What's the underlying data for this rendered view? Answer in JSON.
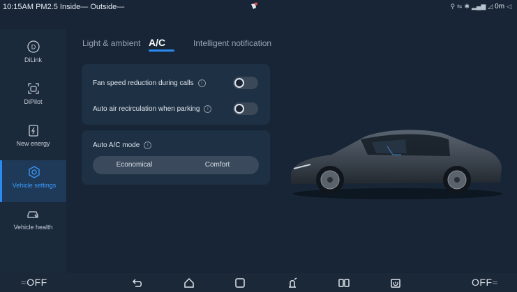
{
  "status_bar": {
    "left_text": "10:15AM PM2.5 Inside— Outside—",
    "right_text": "0m",
    "right_icons": [
      "location-icon",
      "usb-icon",
      "bluetooth-icon",
      "signal-icon",
      "battery-icon"
    ]
  },
  "sidebar": {
    "items": [
      {
        "label": "DiLink",
        "icon": "dilink-icon",
        "active": false
      },
      {
        "label": "DiPilot",
        "icon": "dipilot-icon",
        "active": false
      },
      {
        "label": "New energy",
        "icon": "battery-icon",
        "active": false
      },
      {
        "label": "Vehicle settings",
        "icon": "vehicle-settings-icon",
        "active": true
      },
      {
        "label": "Vehicle health",
        "icon": "vehicle-health-icon",
        "active": false
      }
    ]
  },
  "tabs": [
    {
      "label": "Light & ambient",
      "active": false
    },
    {
      "label": "A/C",
      "active": true
    },
    {
      "label": "Intelligent notification",
      "active": false
    }
  ],
  "settings": {
    "fan_speed_label": "Fan speed reduction during calls",
    "fan_speed_on": false,
    "recirculation_label": "Auto air recirculation when parking",
    "recirculation_on": false,
    "ac_mode_label": "Auto A/C mode",
    "ac_mode_options": [
      "Economical",
      "Comfort"
    ]
  },
  "bottom_bar": {
    "left_label": "OFF",
    "right_label": "OFF",
    "icons": [
      "back-icon",
      "home-icon",
      "recents-icon",
      "climate-fan-icon",
      "split-screen-icon",
      "camera-icon"
    ]
  },
  "colors": {
    "accent": "#2a8af0",
    "background": "#172536",
    "card": "#1e3044"
  }
}
